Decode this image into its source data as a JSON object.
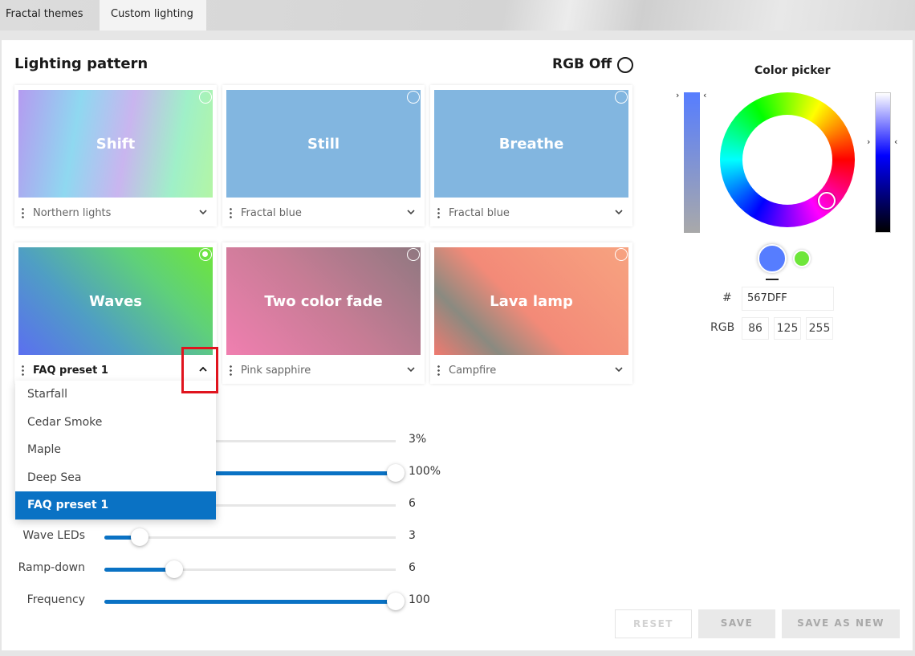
{
  "tabs": [
    {
      "label": "Fractal themes",
      "active": false
    },
    {
      "label": "Custom lighting",
      "active": true
    }
  ],
  "lighting": {
    "title": "Lighting pattern",
    "rgb_off_label": "RGB Off",
    "cards": [
      {
        "name": "Shift",
        "preset": "Northern lights",
        "checked": false
      },
      {
        "name": "Still",
        "preset": "Fractal blue",
        "checked": false
      },
      {
        "name": "Breathe",
        "preset": "Fractal blue",
        "checked": false
      },
      {
        "name": "Waves",
        "preset": "FAQ preset 1",
        "checked": true
      },
      {
        "name": "Two color fade",
        "preset": "Pink sapphire",
        "checked": false
      },
      {
        "name": "Lava lamp",
        "preset": "Campfire",
        "checked": false
      }
    ]
  },
  "dropdown": {
    "items": [
      "Starfall",
      "Cedar Smoke",
      "Maple",
      "Deep Sea",
      "FAQ preset 1"
    ],
    "selected": "FAQ preset 1"
  },
  "sliders": [
    {
      "label": "",
      "value_text": "3%",
      "fraction": 0.03
    },
    {
      "label": "",
      "value_text": "100%",
      "fraction": 1.0
    },
    {
      "label": "",
      "value_text": "6",
      "fraction": 0.3
    },
    {
      "label": "Wave LEDs",
      "value_text": "3",
      "fraction": 0.12
    },
    {
      "label": "Ramp-down",
      "value_text": "6",
      "fraction": 0.24
    },
    {
      "label": "Frequency",
      "value_text": "100",
      "fraction": 1.0
    }
  ],
  "color_picker": {
    "title": "Color picker",
    "hash_label": "#",
    "hex": "567DFF",
    "rgb_label": "RGB",
    "r": "86",
    "g": "125",
    "b": "255",
    "current_color": "#567dff",
    "secondary_color": "#6ee63a"
  },
  "actions": {
    "reset": "RESET",
    "save": "SAVE",
    "save_as_new": "SAVE AS NEW"
  },
  "colors": {
    "accent": "#0a72c4",
    "highlight": "#e0141e"
  }
}
